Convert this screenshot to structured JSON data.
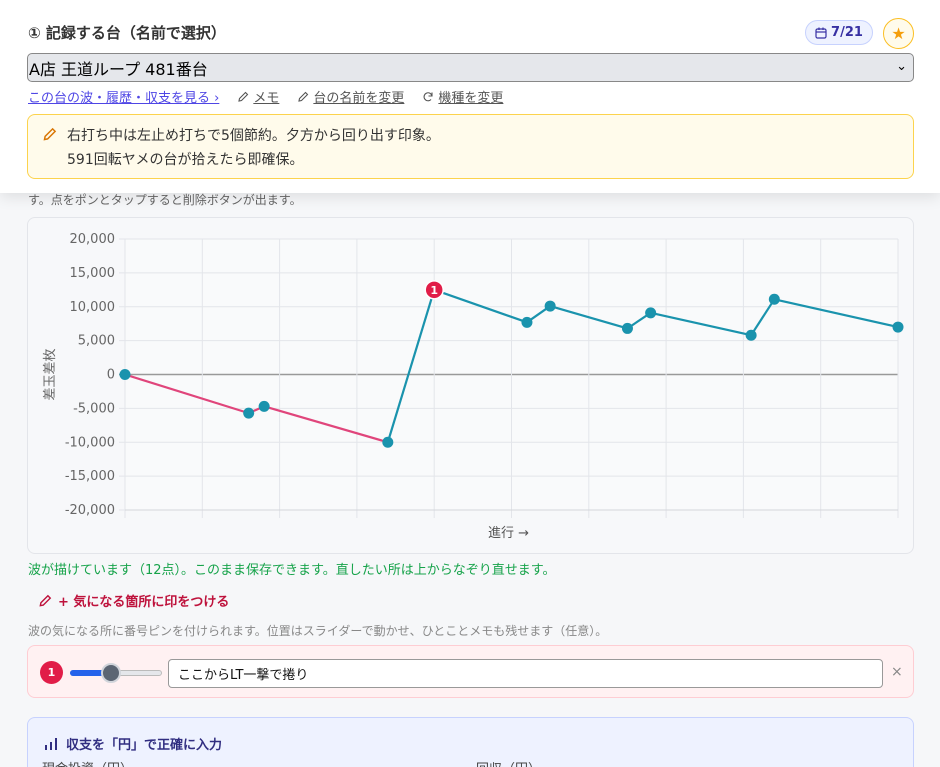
{
  "header": {
    "title": "① 記録する台（名前で選択）",
    "date_badge": "7/21",
    "favorite_icon": "star-icon",
    "machine_select_value": "A店 王道ループ 481番台"
  },
  "links": {
    "history": "この台の波・履歴・収支を見る ›",
    "memo": "メモ",
    "rename": "台の名前を変更",
    "change_model": "機種を変更"
  },
  "memo": {
    "line1": "右打ち中は左止め打ちで5個節約。夕方から回り出す印象。",
    "line2": "591回転ヤメの台が拾えたら即確保。"
  },
  "instructions": "す。点をポンとタップすると削除ボタンが出ます。",
  "chart_data": {
    "type": "line",
    "xlabel": "進行 →",
    "ylabel": "差玉差枚",
    "ylim": [
      -20000,
      20000
    ],
    "yticks": [
      "20,000",
      "15,000",
      "10,000",
      "5,000",
      "0",
      "-5,000",
      "-10,000",
      "-15,000",
      "-20,000"
    ],
    "ytick_values": [
      20000,
      15000,
      10000,
      5000,
      0,
      -5000,
      -10000,
      -15000,
      -20000
    ],
    "x": [
      0,
      1.6,
      1.8,
      3.4,
      4.0,
      5.2,
      5.5,
      6.5,
      6.8,
      8.1,
      8.4,
      10.0
    ],
    "y": [
      0,
      -5700,
      -4700,
      -10000,
      12500,
      7700,
      10100,
      6800,
      9100,
      5800,
      11100,
      7000
    ],
    "xlim": [
      0,
      10
    ],
    "pins": [
      {
        "label": "1",
        "point_index": 4
      }
    ],
    "colors": {
      "negative": "#e0457b",
      "positive": "#1a93ad",
      "pin": "#e11d48",
      "zero_line": "#999999"
    },
    "grid": true
  },
  "status_message": "波が描けています（12点）。このまま保存できます。直したい所は上からなぞり直せます。",
  "mark_button": "+ 気になる箇所に印をつける",
  "mark_help": "波の気になる所に番号ピンを付けられます。位置はスライダーで動かせ、ひとことメモも残せます（任意）。",
  "pin": {
    "number": "1",
    "slider_value": 0.45,
    "note": "ここからLT一撃で捲り",
    "close": "×"
  },
  "income": {
    "title": "収支を「円」で正確に入力",
    "investment_label": "現金投資（円）",
    "return_label": "回収（円）"
  }
}
